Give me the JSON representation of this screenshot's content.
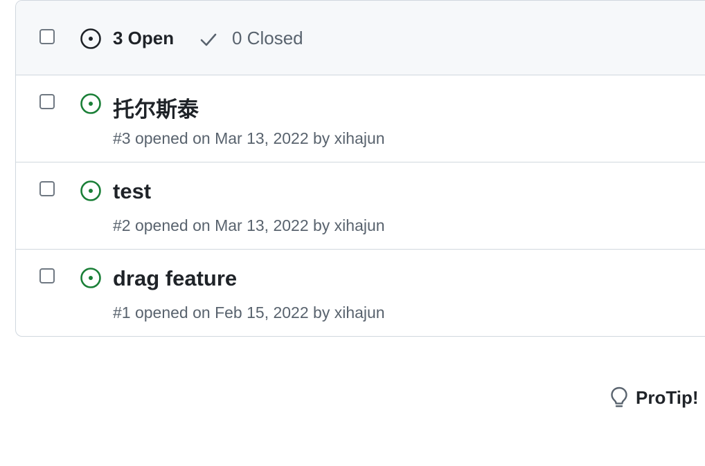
{
  "header": {
    "open_label": "3 Open",
    "closed_label": "0 Closed"
  },
  "issues": [
    {
      "title": "托尔斯泰",
      "meta": "#3 opened on Mar 13, 2022 by xihajun",
      "state": "open"
    },
    {
      "title": "test",
      "meta": "#2 opened on Mar 13, 2022 by xihajun",
      "state": "open"
    },
    {
      "title": "drag feature",
      "meta": "#1 opened on Feb 15, 2022 by xihajun",
      "state": "open"
    }
  ],
  "footer": {
    "protip_label": "ProTip!"
  },
  "colors": {
    "open_green": "#1a7f37",
    "border": "#d0d7de",
    "header_bg": "#f6f8fa",
    "muted_text": "#59636e"
  },
  "icons": {
    "header_state": "issue-opened-icon",
    "closed_tab": "check-icon",
    "issue_state": "issue-opened-icon",
    "protip": "light-bulb-icon"
  }
}
